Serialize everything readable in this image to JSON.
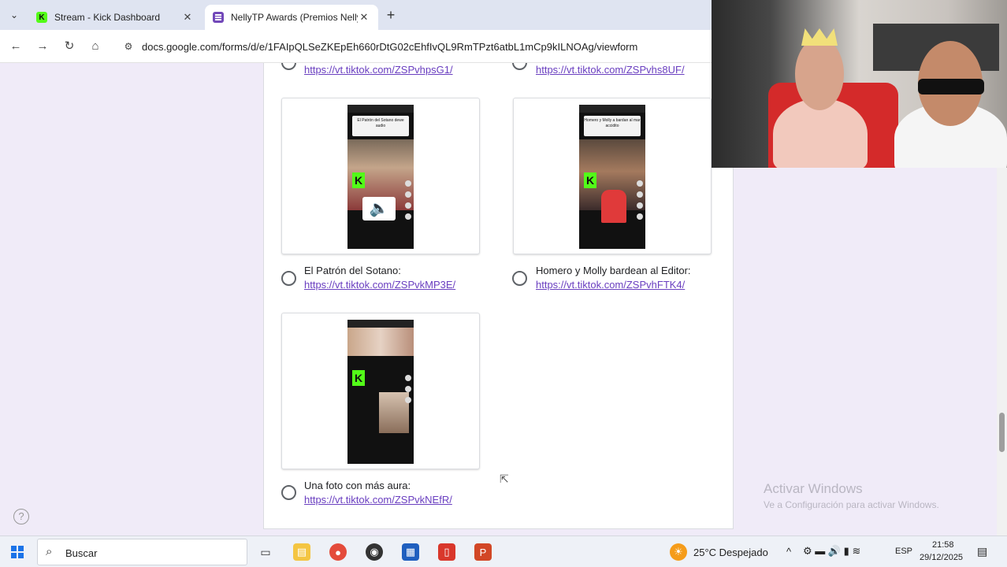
{
  "browser": {
    "tabs": [
      {
        "title": "Stream - Kick Dashboard",
        "icon": "kick-icon",
        "active": false
      },
      {
        "title": "NellyTP Awards (Premios Nelly",
        "icon": "google-forms-icon",
        "active": true
      }
    ],
    "url": "docs.google.com/forms/d/e/1FAIpQLSeZKEpEh660rDtG02cEhfIvQL9RmTPzt6atbL1mCp9kILNOAg/viewform"
  },
  "form": {
    "top_options": [
      {
        "link": "https://vt.tiktok.com/ZSPvhpsG1/"
      },
      {
        "link": "https://vt.tiktok.com/ZSPvhs8UF/"
      }
    ],
    "options": [
      {
        "label": "El Patrón del Sotano:",
        "link": "https://vt.tiktok.com/ZSPvkMP3E/",
        "thumb_header": "El Patrón del Sotano dewe audio",
        "has_speaker": true
      },
      {
        "label": "Homero y Molly bardean al Editor:",
        "link": "https://vt.tiktok.com/ZSPvhFTK4/",
        "thumb_header": "Homero y Molly a bardan al mar accidito",
        "has_speaker": false
      },
      {
        "label": "Una foto con más aura:",
        "link": "https://vt.tiktok.com/ZSPvkNEfR/",
        "thumb_header": "",
        "has_speaker": false
      }
    ]
  },
  "watermark": {
    "title": "Activar Windows",
    "subtitle": "Ve a Configuración para activar Windows."
  },
  "taskbar": {
    "search_label": "Buscar",
    "weather": "25°C  Despejado",
    "language": "ESP",
    "time": "21:58",
    "date": "29/12/2025"
  },
  "colors": {
    "form_bg": "#f0ebf8",
    "link": "#6a3fc0",
    "kick_green": "#53fc18",
    "forms_purple": "#7248b9"
  }
}
